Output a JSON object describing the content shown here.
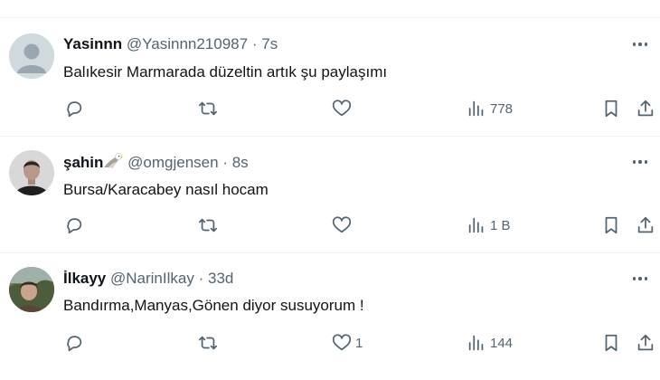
{
  "tweets": [
    {
      "name": "Yasinnn",
      "handle": "@Yasinnn210987",
      "separator": "·",
      "time": "7s",
      "text": "Balıkesir Marmarada düzeltin artık şu paylaşımı",
      "avatar": "default-avatar",
      "replies": "",
      "retweets": "",
      "likes": "",
      "views": "778"
    },
    {
      "name": "şahin",
      "name_badge": "eagle-emoji",
      "handle": "@omgjensen",
      "separator": "·",
      "time": "8s",
      "text": "Bursa/Karacabey nasıl hocam",
      "avatar": "photo-avatar-man",
      "replies": "",
      "retweets": "",
      "likes": "",
      "views": "1 B"
    },
    {
      "name": "İlkayy",
      "handle": "@NarinIlkay",
      "separator": "·",
      "time": "33d",
      "text": "Bandırma,Manyas,Gönen diyor susuyorum !",
      "avatar": "photo-avatar-landscape",
      "replies": "",
      "retweets": "",
      "likes": "1",
      "views": "144"
    }
  ],
  "colors": {
    "text": "#0f1419",
    "secondary": "#536471",
    "divider": "#eff3f4"
  },
  "icons": [
    "reply-icon",
    "retweet-icon",
    "like-icon",
    "views-icon",
    "bookmark-icon",
    "share-icon",
    "more-icon"
  ]
}
